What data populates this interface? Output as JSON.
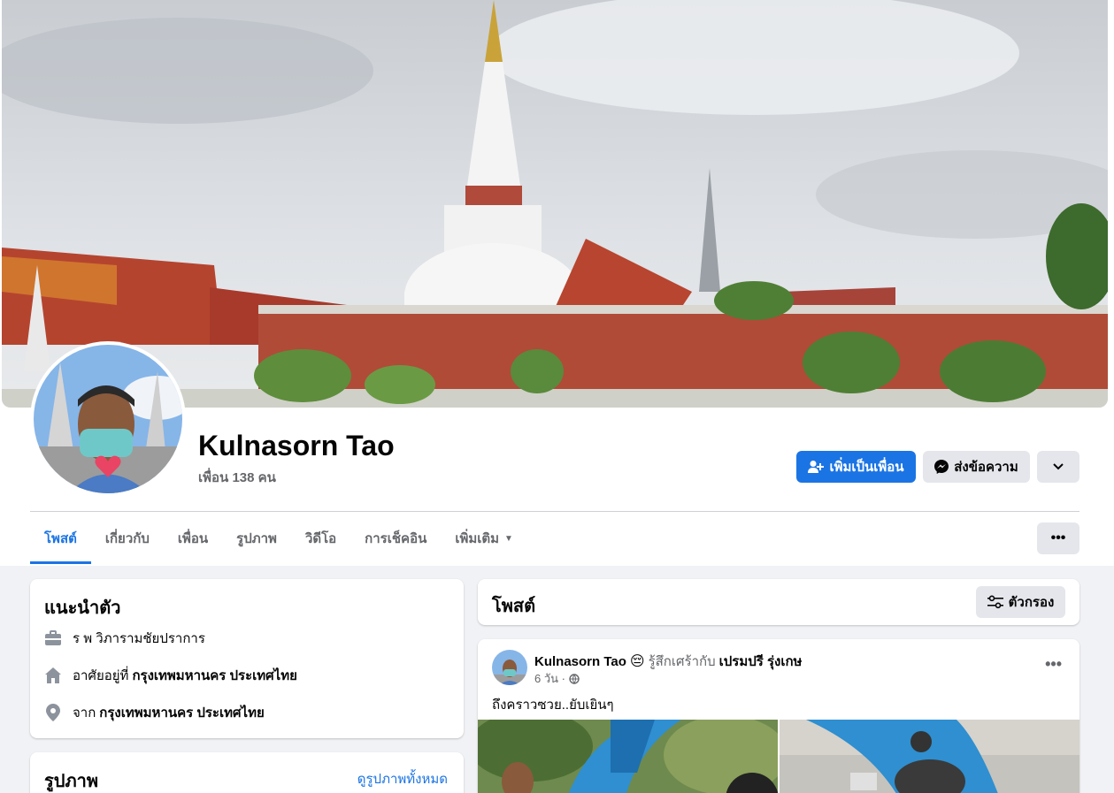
{
  "profile": {
    "name": "Kulnasorn Tao",
    "friends": "เพื่อน 138 คน"
  },
  "actions": {
    "add_friend": "เพิ่มเป็นเพื่อน",
    "message": "ส่งข้อความ"
  },
  "tabs": [
    {
      "label": "โพสต์"
    },
    {
      "label": "เกี่ยวกับ"
    },
    {
      "label": "เพื่อน"
    },
    {
      "label": "รูปภาพ"
    },
    {
      "label": "วิดีโอ"
    },
    {
      "label": "การเช็คอิน"
    },
    {
      "label": "เพิ่มเติม"
    }
  ],
  "intro": {
    "title": "แนะนำตัว",
    "work": "ร พ วิภารามชัยปราการ",
    "lives_prefix": "อาศัยอยู่ที่",
    "lives_place": "กรุงเทพมหานคร ประเทศไทย",
    "from_prefix": "จาก",
    "from_place": "กรุงเทพมหานคร ประเทศไทย"
  },
  "photos": {
    "title": "รูปภาพ",
    "see_all": "ดูรูปภาพทั้งหมด"
  },
  "posts": {
    "title": "โพสต์",
    "filter": "ตัวกรอง"
  },
  "post": {
    "author": "Kulnasorn Tao",
    "feeling": "รู้สึกเศร้ากับ",
    "tagged": "เปรมปรี รุ่งเกษ",
    "time": "6 วัน ·",
    "text": "ถึงคราวซวย..ยับเยินๆ"
  },
  "colors": {
    "accent": "#1b74e4",
    "page_bg": "#f0f2f5",
    "secondary_btn": "#e4e6eb"
  }
}
